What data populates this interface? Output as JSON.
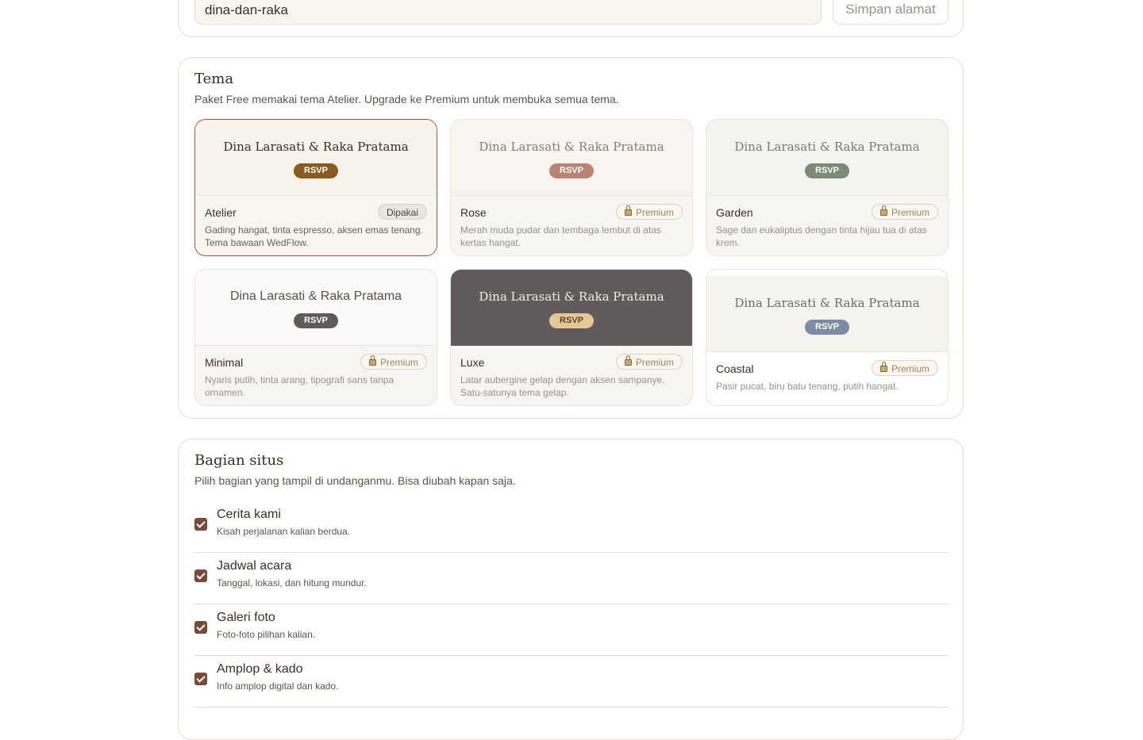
{
  "slug": {
    "value": "dina-dan-raka",
    "save_label": "Simpan alamat"
  },
  "theme": {
    "title": "Tema",
    "subtitle": "Paket Free memakai tema Atelier. Upgrade ke Premium untuk membuka semua tema.",
    "couple_names": "Dina Larasati & Raka Pratama",
    "rsvp_label": "RSVP",
    "items": [
      {
        "name": "Atelier",
        "badge": "Dipakai",
        "desc": "Gading hangat, tinta espresso, aksen emas tenang. Tema bawaan WedFlow.",
        "preview_bg": "#f7f2ea",
        "name_color": "#3a2a22",
        "rsvp_bg": "#8a5a1e",
        "rsvp_fg": "#ffffff"
      },
      {
        "name": "Rose",
        "badge": "Premium",
        "desc": "Merah muda pudar dan tembaga lembut di atas kertas hangat.",
        "preview_bg": "#f8f4f0",
        "name_color": "#8a7a74",
        "rsvp_bg": "#b98474",
        "rsvp_fg": "#ffffff"
      },
      {
        "name": "Garden",
        "badge": "Premium",
        "desc": "Sage dan eukaliptus dengan tinta hijau tua di atas krem.",
        "preview_bg": "#f4f4ef",
        "name_color": "#7a7a72",
        "rsvp_bg": "#7c8a78",
        "rsvp_fg": "#ffffff"
      },
      {
        "name": "Minimal",
        "badge": "Premium",
        "desc": "Nyaris putih, tinta arang, tipografi sans tanpa ornamen.",
        "preview_bg": "#fbfaf8",
        "name_color": "#55504c",
        "rsvp_bg": "#5f5b58",
        "rsvp_fg": "#ffffff"
      },
      {
        "name": "Luxe",
        "badge": "Premium",
        "desc": "Latar aubergine gelap dengan aksen sampanye. Satu-satunya tema gelap.",
        "preview_bg": "#625b5b",
        "name_color": "#f2ece4",
        "rsvp_bg": "#e6c796",
        "rsvp_fg": "#5a4630"
      },
      {
        "name": "Coastal",
        "badge": "Premium",
        "desc": "Pasir pucat, biru batu tenang, putih hangat.",
        "preview_bg": "#f4f3ee",
        "name_color": "#6f6b66",
        "rsvp_bg": "#7b8da6",
        "rsvp_fg": "#ffffff"
      }
    ]
  },
  "sections": {
    "title": "Bagian situs",
    "subtitle": "Pilih bagian yang tampil di undanganmu. Bisa diubah kapan saja.",
    "items": [
      {
        "title": "Cerita kami",
        "desc": "Kisah perjalanan kalian berdua.",
        "checked": true
      },
      {
        "title": "Jadwal acara",
        "desc": "Tanggal, lokasi, dan hitung mundur.",
        "checked": true
      },
      {
        "title": "Galeri foto",
        "desc": "Foto-foto pilihan kalian.",
        "checked": true
      },
      {
        "title": "Amplop & kado",
        "desc": "Info amplop digital dan kado.",
        "checked": true
      }
    ]
  },
  "colors": {
    "accent": "#7a4a37",
    "selected_border": "#a7593f"
  }
}
